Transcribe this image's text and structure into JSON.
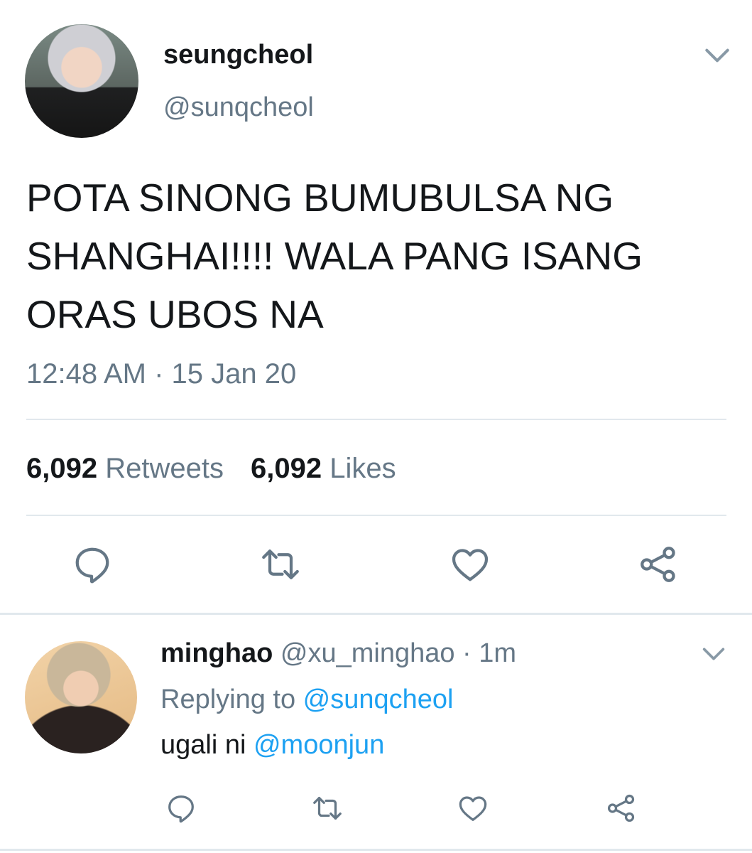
{
  "main_tweet": {
    "display_name": "seungcheol",
    "handle": "@sunqcheol",
    "text": "POTA SINONG BUMUBULSA NG SHANGHAI!!!! WALA PANG ISANG ORAS UBOS NA",
    "timestamp": "12:48 AM · 15 Jan 20",
    "retweets_count": "6,092",
    "retweets_label": "Retweets",
    "likes_count": "6,092",
    "likes_label": "Likes",
    "actions": [
      "reply-icon",
      "retweet-icon",
      "like-icon",
      "share-icon"
    ]
  },
  "reply": {
    "display_name": "minghao",
    "meta": "@xu_minghao · 1m",
    "replying_prefix": "Replying to ",
    "replying_to": "@sunqcheol",
    "text_prefix": "ugali ni ",
    "mention": "@moonjun",
    "actions": [
      "reply-icon",
      "retweet-icon",
      "like-icon",
      "share-icon"
    ]
  },
  "colors": {
    "text": "#14171a",
    "secondary": "#657786",
    "link": "#1da1f2",
    "divider": "#e1e8ed"
  }
}
